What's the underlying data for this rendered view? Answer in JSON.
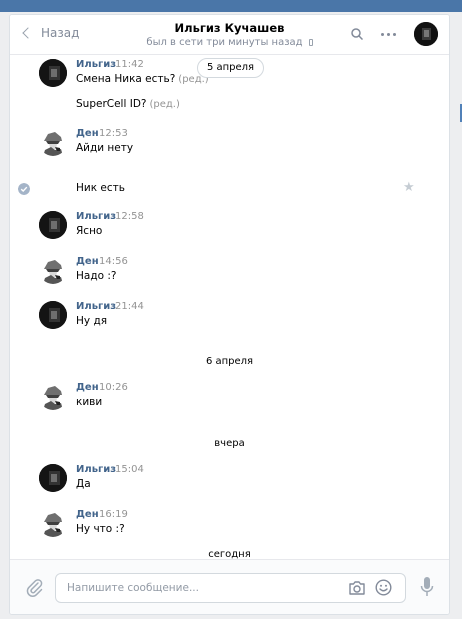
{
  "header": {
    "back_label": "Назад",
    "title": "Ильгиз Кучашев",
    "status": "был в сети три минуты назад"
  },
  "icons": {
    "search": "search-icon",
    "more": "more-icon",
    "attach": "paperclip-icon",
    "camera": "camera-icon",
    "emoji": "smile-icon",
    "voice": "microphone-icon",
    "read": "check-icon",
    "favorite": "star-icon"
  },
  "colors": {
    "topbar": "#4a76a8",
    "author": "#42648b",
    "meta": "#939393"
  },
  "history": {
    "date_pill": "5 апреля",
    "messages": [
      {
        "author": "Ильгиз",
        "time": "11:42",
        "text": "Смена Ника есть?",
        "edited": "(ред.)"
      },
      {
        "text": "SuperCell ID?",
        "edited": "(ред.)"
      },
      {
        "author": "Ден",
        "time": "12:53",
        "text": "Айди нету"
      },
      {
        "text": "Ник есть"
      },
      {
        "author": "Ильгиз",
        "time": "12:58",
        "text": "Ясно"
      },
      {
        "author": "Ден",
        "time": "14:56",
        "text": "Надо :?"
      },
      {
        "author": "Ильгиз",
        "time": "21:44",
        "text": "Ну дя"
      },
      {
        "author": "Ден",
        "time": "10:26",
        "text": "киви"
      },
      {
        "author": "Ильгиз",
        "time": "15:04",
        "text": "Да"
      },
      {
        "author": "Ден",
        "time": "16:19",
        "text": "Ну что :?"
      }
    ],
    "dates": [
      "6 апреля",
      "вчера",
      "сегодня"
    ]
  },
  "composer": {
    "placeholder": "Напишите сообщение..."
  }
}
